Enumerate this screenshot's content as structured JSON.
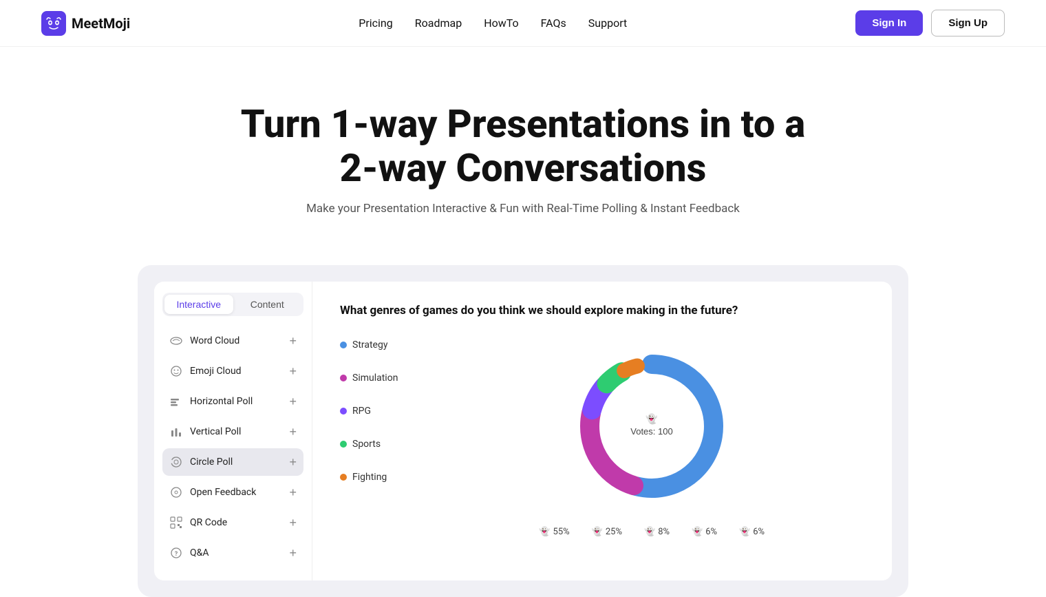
{
  "nav": {
    "logo_text": "MeetMoji",
    "links": [
      {
        "label": "Pricing",
        "id": "pricing"
      },
      {
        "label": "Roadmap",
        "id": "roadmap"
      },
      {
        "label": "HowTo",
        "id": "howto"
      },
      {
        "label": "FAQs",
        "id": "faqs"
      },
      {
        "label": "Support",
        "id": "support"
      }
    ],
    "signin_label": "Sign In",
    "signup_label": "Sign Up"
  },
  "hero": {
    "headline_line1": "Turn 1-way Presentations in to a",
    "headline_line2": "2-way Conversations",
    "subtitle": "Make your Presentation Interactive & Fun with Real-Time Polling & Instant Feedback"
  },
  "demo": {
    "tabs": [
      {
        "label": "Interactive",
        "active": true
      },
      {
        "label": "Content",
        "active": false
      }
    ],
    "sidebar_items": [
      {
        "label": "Word Cloud",
        "id": "word-cloud",
        "active": false
      },
      {
        "label": "Emoji Cloud",
        "id": "emoji-cloud",
        "active": false
      },
      {
        "label": "Horizontal Poll",
        "id": "horizontal-poll",
        "active": false
      },
      {
        "label": "Vertical Poll",
        "id": "vertical-poll",
        "active": false
      },
      {
        "label": "Circle Poll",
        "id": "circle-poll",
        "active": true
      },
      {
        "label": "Open Feedback",
        "id": "open-feedback",
        "active": false
      },
      {
        "label": "QR Code",
        "id": "qr-code",
        "active": false
      },
      {
        "label": "Q&A",
        "id": "qa",
        "active": false
      }
    ],
    "chart": {
      "question": "What genres of games do you think we should explore making in the future?",
      "center_label": "Votes: 100",
      "segments": [
        {
          "label": "Strategy",
          "color": "#4a90e2",
          "pct": 55,
          "start": 0,
          "end": 198
        },
        {
          "label": "Simulation",
          "color": "#c03aaa",
          "pct": 25,
          "start": 198,
          "end": 288
        },
        {
          "label": "RPG",
          "color": "#7c4dff",
          "pct": 8,
          "start": 288,
          "end": 316.8
        },
        {
          "label": "Sports",
          "color": "#2ecc71",
          "pct": 6,
          "start": 316.8,
          "end": 338.4
        },
        {
          "label": "Fighting",
          "color": "#e67e22",
          "pct": 6,
          "start": 338.4,
          "end": 360
        }
      ],
      "bar_stats": [
        {
          "pct": "55%",
          "color": "#4a90e2"
        },
        {
          "pct": "25%",
          "color": "#c03aaa"
        },
        {
          "pct": "8%",
          "color": "#7c4dff"
        },
        {
          "pct": "6%",
          "color": "#2ecc71"
        },
        {
          "pct": "6%",
          "color": "#e67e22"
        }
      ]
    }
  }
}
